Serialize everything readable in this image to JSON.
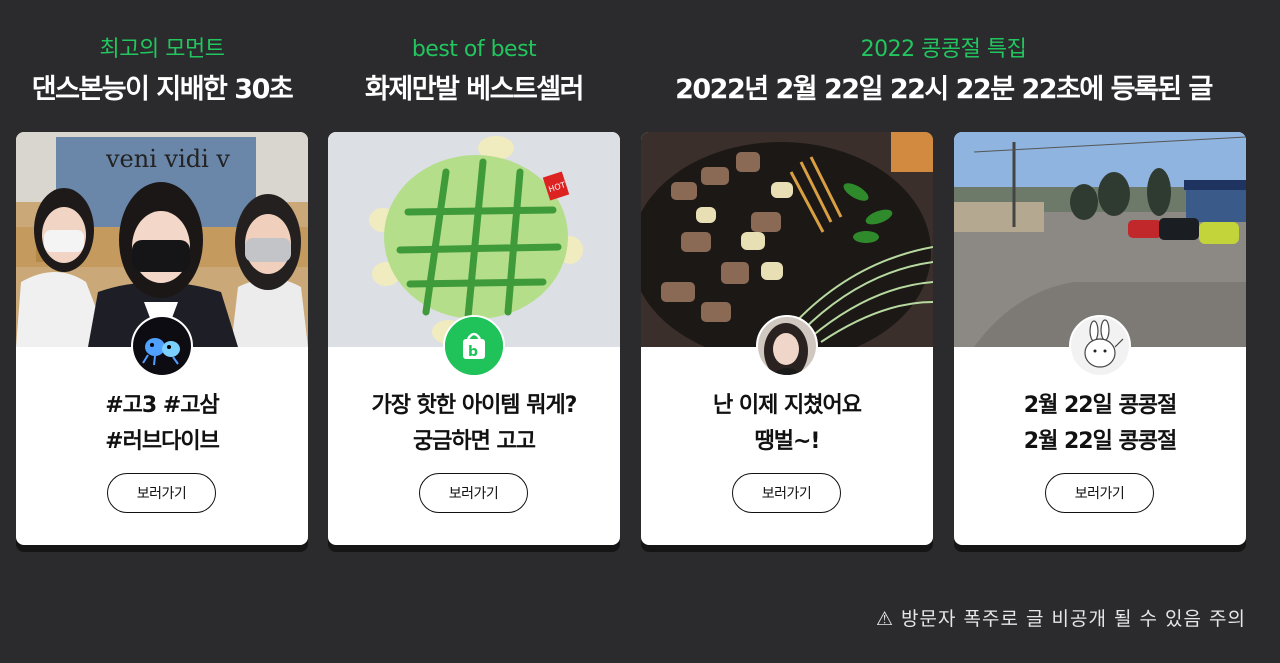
{
  "sections": [
    {
      "eyebrow": "최고의 모먼트",
      "title": "댄스본능이 지배한 30초"
    },
    {
      "eyebrow": "best of best",
      "title": "화제만발 베스트셀러"
    },
    {
      "eyebrow": "2022 콩콩절 특집",
      "title": "2022년 2월 22일 22시 22분 22초에 등록된 글"
    }
  ],
  "cards": [
    {
      "line1": "#고3 #고삼",
      "line2": "#러브다이브",
      "button": "보러가기",
      "photo_text": "veni vidi v"
    },
    {
      "line1": "가장 핫한 아이템 뭐게?",
      "line2": "궁금하면 고고",
      "button": "보러가기",
      "tag_text": "HOT"
    },
    {
      "line1": "난 이제 지쳤어요",
      "line2": "땡벌~!",
      "button": "보러가기"
    },
    {
      "line1": "2월 22일 콩콩절",
      "line2": "2월 22일 콩콩절",
      "button": "보러가기"
    }
  ],
  "avatars": {
    "shop_icon_glyph": "b"
  },
  "notice": "⚠ 방문자 폭주로 글 비공개 될 수 있음 주의",
  "colors": {
    "background": "#2b2a2d",
    "accent_green": "#22c55e",
    "card": "#ffffff"
  }
}
